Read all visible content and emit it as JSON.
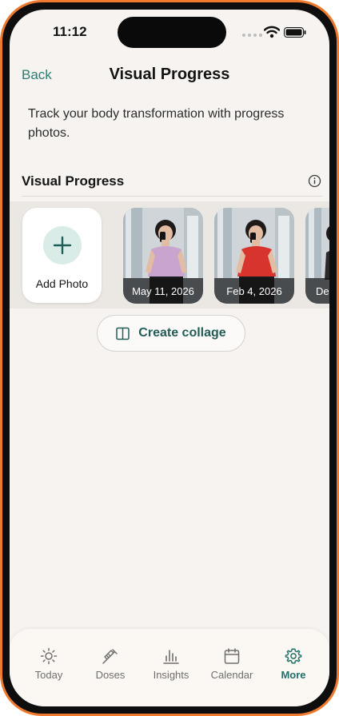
{
  "status_bar": {
    "time": "11:12"
  },
  "header": {
    "back_label": "Back",
    "title": "Visual Progress"
  },
  "description": "Track your body transformation with progress photos.",
  "section": {
    "title": "Visual Progress",
    "info_icon": "info-icon"
  },
  "photos": {
    "add_label": "Add Photo",
    "items": [
      {
        "date": "May 11, 2026",
        "top_color": "#c9a4cf"
      },
      {
        "date": "Feb 4, 2026",
        "top_color": "#d8342e"
      },
      {
        "date": "Dec"
      }
    ]
  },
  "collage_button": {
    "label": "Create collage",
    "icon": "collage-icon"
  },
  "tab_bar": {
    "items": [
      {
        "label": "Today",
        "icon": "sun-icon"
      },
      {
        "label": "Doses",
        "icon": "syringe-icon"
      },
      {
        "label": "Insights",
        "icon": "bar-chart-icon"
      },
      {
        "label": "Calendar",
        "icon": "calendar-icon"
      },
      {
        "label": "More",
        "icon": "gear-icon",
        "active": true
      }
    ]
  },
  "colors": {
    "accent": "#2a7d73",
    "frame": "#ef7a2e",
    "background": "#f6f3f0"
  }
}
